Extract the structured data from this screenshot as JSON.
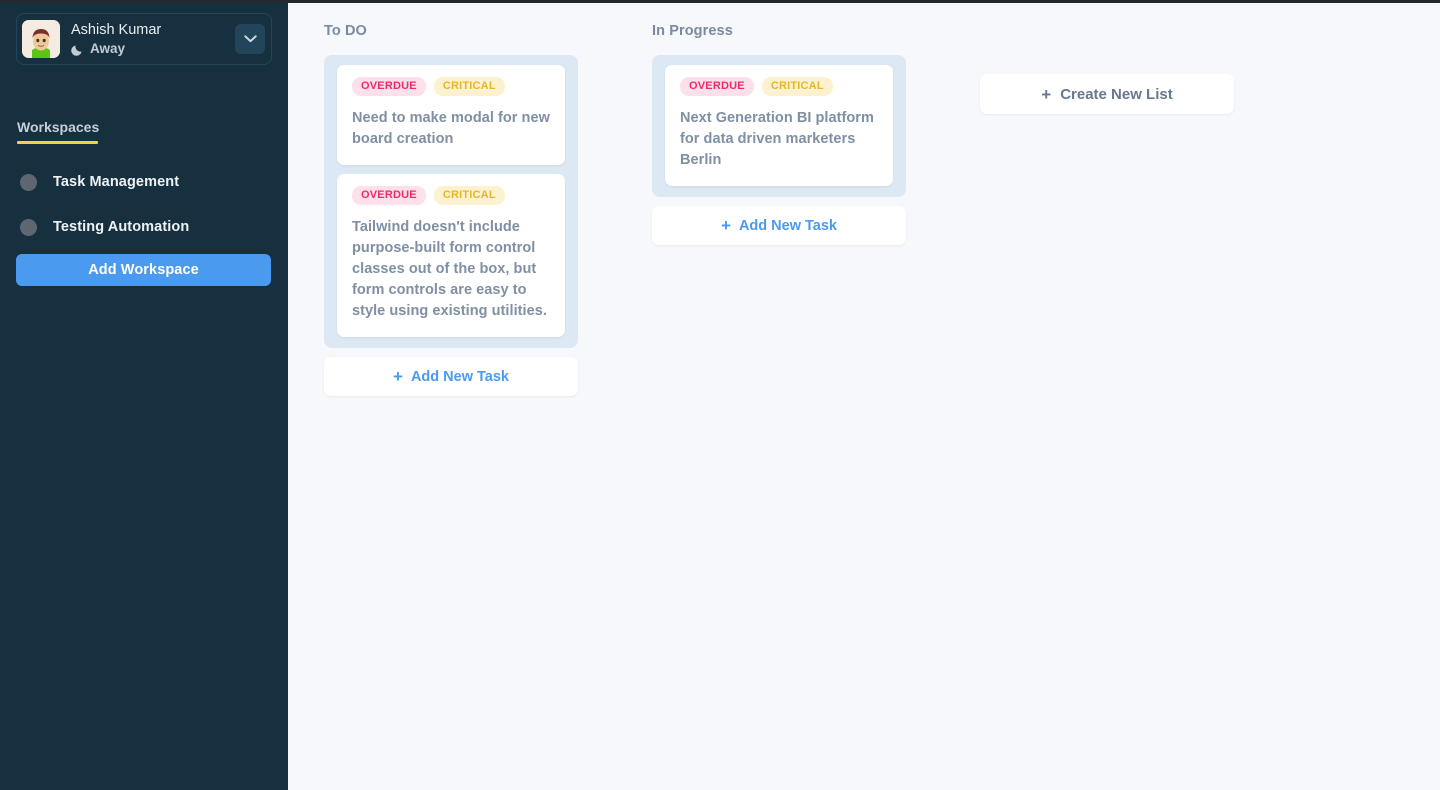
{
  "sidebar": {
    "profile": {
      "name": "Ashish Kumar",
      "status": "Away",
      "status_icon": "moon-icon",
      "avatar_icon": "avatar-image",
      "expand_icon": "chevron-down-icon"
    },
    "workspaces_heading": "Workspaces",
    "workspace_items": [
      {
        "label": "Task Management",
        "icon": "circle-dot-icon"
      },
      {
        "label": "Testing Automation",
        "icon": "circle-dot-icon"
      }
    ],
    "add_workspace_label": "Add Workspace",
    "colors": {
      "background": "#17303f",
      "accent_underline": "#f2d24b",
      "primary_button": "#4a9bf0"
    }
  },
  "board": {
    "plus_glyph": "+",
    "columns": [
      {
        "title": "To DO",
        "add_task_label": "Add New Task",
        "tasks": [
          {
            "badges": [
              {
                "label": "OVERDUE",
                "type": "overdue"
              },
              {
                "label": "CRITICAL",
                "type": "critical"
              }
            ],
            "text": "Need to make modal for new board creation"
          },
          {
            "badges": [
              {
                "label": "OVERDUE",
                "type": "overdue"
              },
              {
                "label": "CRITICAL",
                "type": "critical"
              }
            ],
            "text": "Tailwind doesn't include purpose-built form control classes out of the box, but form controls are easy to style using existing utilities."
          }
        ]
      },
      {
        "title": "In Progress",
        "add_task_label": "Add New Task",
        "tasks": [
          {
            "badges": [
              {
                "label": "OVERDUE",
                "type": "overdue"
              },
              {
                "label": "CRITICAL",
                "type": "critical"
              }
            ],
            "text": "Next Generation BI platform for data driven marketers Berlin"
          }
        ]
      }
    ],
    "create_list_label": "Create New List",
    "colors": {
      "background": "#f6f8fc",
      "dropzone": "#dce8f3",
      "card": "#ffffff",
      "badge_overdue_bg": "#fde0ea",
      "badge_overdue_text": "#f02b6b",
      "badge_critical_bg": "#fdf2cf",
      "badge_critical_text": "#e9b623",
      "task_text": "#7f8fa4",
      "column_title": "#7b8aa0",
      "link_blue": "#4a9bf0"
    }
  }
}
